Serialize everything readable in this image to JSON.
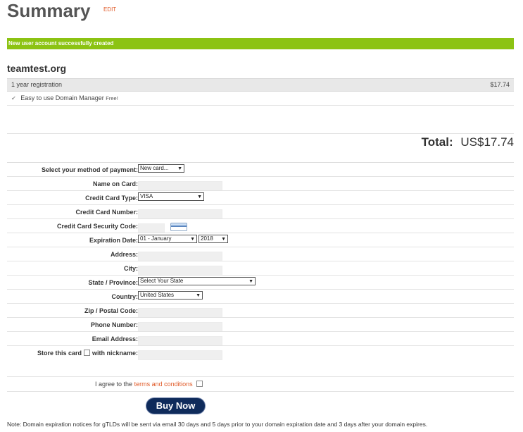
{
  "summary": {
    "title": "Summary",
    "edit_label": "EDIT"
  },
  "notice": {
    "text": "New user account successfully created"
  },
  "order": {
    "domain": "teamtest.org",
    "registration_label": "1 year registration",
    "registration_price": "$17.74",
    "addon_label": "Easy to use Domain Manager",
    "addon_tag": "Free!",
    "addon_checked": true
  },
  "total": {
    "label": "Total:",
    "value": "US$17.74"
  },
  "payment_form": {
    "payment_method": {
      "label": "Select your method of payment:",
      "value": "New card..."
    },
    "name_on_card": {
      "label": "Name on Card:",
      "value": ""
    },
    "card_type": {
      "label": "Credit Card Type:",
      "value": "VISA"
    },
    "card_number": {
      "label": "Credit Card Number:",
      "value": ""
    },
    "security_code": {
      "label": "Credit Card Security Code:",
      "value": ""
    },
    "expiration": {
      "label": "Expiration Date:",
      "month": "01 - January",
      "year": "2018"
    },
    "address": {
      "label": "Address:",
      "value": ""
    },
    "city": {
      "label": "City:",
      "value": ""
    },
    "state": {
      "label": "State / Province:",
      "value": "Select Your State"
    },
    "country": {
      "label": "Country:",
      "value": "United States"
    },
    "zip": {
      "label": "Zip / Postal Code:",
      "value": ""
    },
    "phone": {
      "label": "Phone Number:",
      "value": ""
    },
    "email": {
      "label": "Email Address:",
      "value": ""
    },
    "store_card": {
      "label_before": "Store this card",
      "label_after": "with nickname:",
      "value": ""
    }
  },
  "agreement": {
    "text_before": "I agree to the",
    "link_text": "terms and conditions"
  },
  "buy_button": {
    "label": "Buy Now"
  },
  "footnote": {
    "text": "Note: Domain expiration notices for gTLDs will be sent via email 30 days and 5 days prior to your domain expiration date and 3 days after your domain expires."
  },
  "colors": {
    "notice_bg": "#8cc313",
    "link": "#e05a28",
    "button_bg": "#0f2b5b"
  }
}
